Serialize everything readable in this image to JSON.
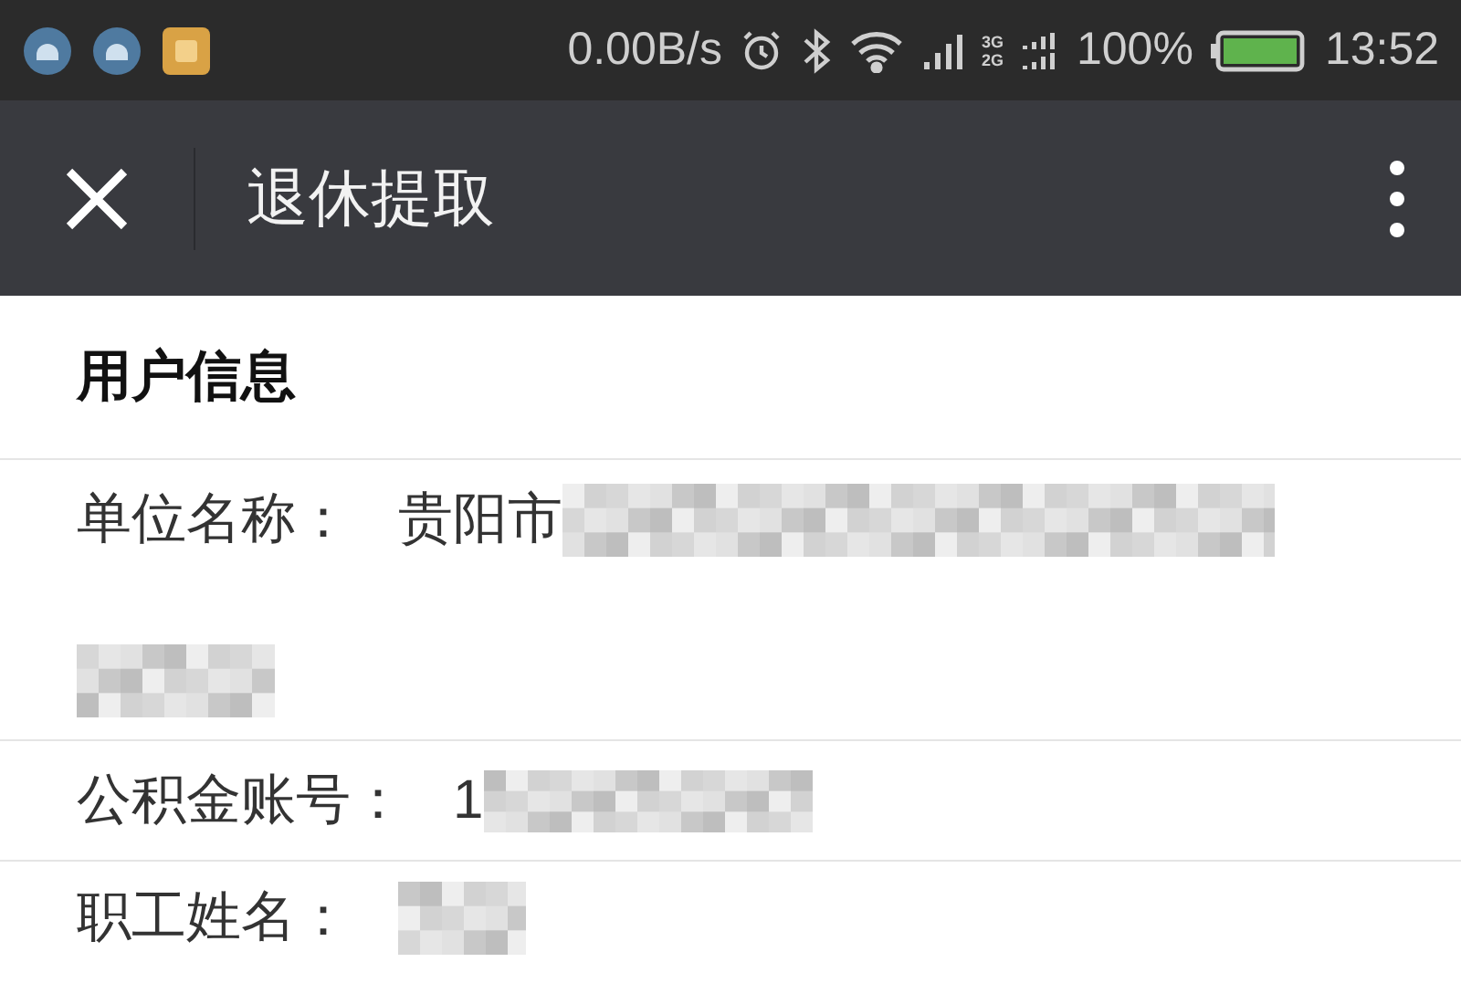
{
  "status_bar": {
    "notifications": [
      {
        "kind": "android",
        "color": "#4f7aa0"
      },
      {
        "kind": "android",
        "color": "#4f7aa0"
      },
      {
        "kind": "app",
        "color": "#d9a245"
      }
    ],
    "speed": "0.00B/s",
    "network_top": "3G",
    "network_bottom": "2G",
    "battery": "100%",
    "time": "13:52"
  },
  "app_bar": {
    "title": "退休提取"
  },
  "section": {
    "title": "用户信息"
  },
  "rows": [
    {
      "label": "单位名称：",
      "value": "贵阳市",
      "kind": "wrapped"
    },
    {
      "label": "公积金账号：",
      "value": "1",
      "kind": "wide"
    },
    {
      "label": "职工姓名：",
      "kind": "narrow"
    }
  ]
}
